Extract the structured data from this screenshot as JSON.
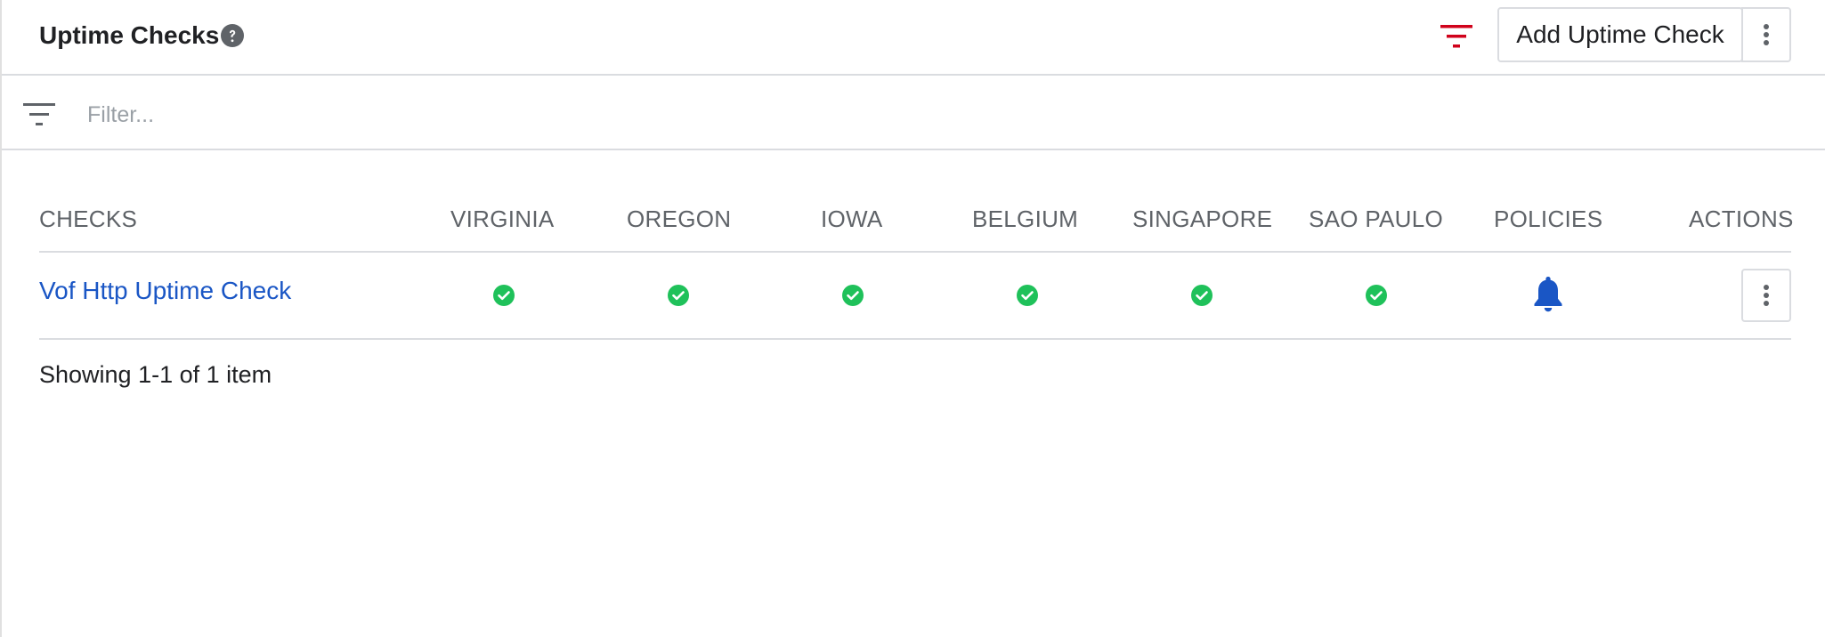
{
  "header": {
    "title": "Uptime Checks",
    "help_icon": "help-circle-icon",
    "filter_icon": "filter-icon",
    "add_button_label": "Add Uptime Check",
    "more_icon": "more-vert-icon"
  },
  "filter": {
    "icon": "filter-list-icon",
    "placeholder": "Filter...",
    "value": ""
  },
  "table": {
    "columns": [
      "CHECKS",
      "VIRGINIA",
      "OREGON",
      "IOWA",
      "BELGIUM",
      "SINGAPORE",
      "SAO PAULO",
      "POLICIES",
      "ACTIONS"
    ],
    "rows": [
      {
        "name": "Vof Http Uptime Check",
        "statuses": [
          "ok",
          "ok",
          "ok",
          "ok",
          "ok",
          "ok"
        ],
        "status_icon": "check-circle-icon",
        "policy_icon": "bell-icon",
        "action_icon": "more-vert-icon"
      }
    ]
  },
  "footer": {
    "summary": "Showing 1-1 of 1 item"
  },
  "colors": {
    "link": "#1a56c5",
    "ok_green": "#1fc15a",
    "filter_red": "#d0021b",
    "bell_blue": "#1a56c5",
    "header_text": "#5f6368",
    "border": "#dadce0"
  }
}
